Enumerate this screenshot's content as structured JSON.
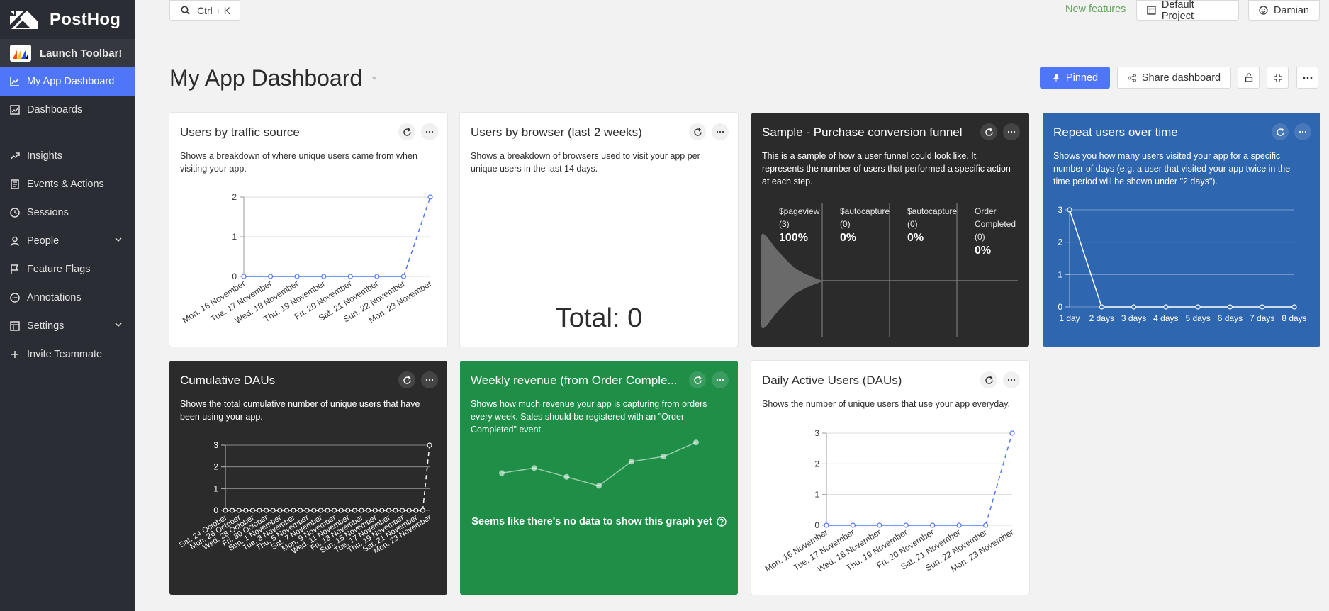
{
  "app": {
    "name": "PostHog"
  },
  "sidebar": {
    "toolbar_label": "Launch Toolbar!",
    "items": [
      {
        "label": "My App Dashboard",
        "icon": "line-chart-icon",
        "active": true
      },
      {
        "label": "Dashboards",
        "icon": "dashboard-icon"
      },
      {
        "label": "Insights",
        "icon": "trend-icon"
      },
      {
        "label": "Events & Actions",
        "icon": "list-icon"
      },
      {
        "label": "Sessions",
        "icon": "clock-icon"
      },
      {
        "label": "People",
        "icon": "user-icon",
        "expandable": true
      },
      {
        "label": "Feature Flags",
        "icon": "flag-icon"
      },
      {
        "label": "Annotations",
        "icon": "comment-icon"
      },
      {
        "label": "Settings",
        "icon": "settings-icon",
        "expandable": true
      },
      {
        "label": "Invite Teammate",
        "icon": "plus-icon"
      }
    ]
  },
  "topbar": {
    "search_label": "Ctrl + K",
    "new_features": "New features",
    "project": "Default Project",
    "user": "Damian"
  },
  "dashboard": {
    "title": "My App Dashboard",
    "pinned_label": "Pinned",
    "share_label": "Share dashboard"
  },
  "colors": {
    "accent": "#4f76f8",
    "sidebar": "#2a2d33",
    "dark_card": "#2b2b2b",
    "blue_card": "#2e66b0",
    "green_card": "#1f8f48",
    "new_features": "#63a35c"
  },
  "cards": {
    "traffic": {
      "title": "Users by traffic source",
      "description": "Shows a breakdown of where unique users came from when visiting your app."
    },
    "browser": {
      "title": "Users by browser (last 2 weeks)",
      "description": "Shows a breakdown of browsers used to visit your app per unique users in the last 14 days.",
      "total": "Total: 0"
    },
    "funnel": {
      "title": "Sample - Purchase conversion funnel",
      "description": "This is a sample of how a user funnel could look like. It represents the number of users that performed a specific action at each step.",
      "steps": [
        {
          "name": "$pageview",
          "count": "(3)",
          "pct": "100%"
        },
        {
          "name": "$autocapture",
          "count": "(0)",
          "pct": "0%"
        },
        {
          "name": "$autocapture",
          "count": "(0)",
          "pct": "0%"
        },
        {
          "name": "Order Completed",
          "count": "(0)",
          "pct": "0%"
        }
      ]
    },
    "repeat": {
      "title": "Repeat users over time",
      "description": "Shows you how many users visited your app for a specific number of days (e.g. a user that visited your app twice in the time period will be shown under \"2 days\")."
    },
    "cumulative": {
      "title": "Cumulative DAUs",
      "description": "Shows the total cumulative number of unique users that have been using your app."
    },
    "revenue": {
      "title": "Weekly revenue (from Order Comple...",
      "description": "Shows how much revenue your app is capturing from orders every week. Sales should be registered with an \"Order Completed\" event.",
      "nodata": "Seems like there's no data to show this graph yet"
    },
    "dau": {
      "title": "Daily Active Users (DAUs)",
      "description": "Shows the number of unique users that use your app everyday."
    }
  },
  "chart_data": [
    {
      "id": "traffic",
      "type": "line",
      "categories": [
        "Mon. 16 November",
        "Tue. 17 November",
        "Wed. 18 November",
        "Thu. 19 November",
        "Fri. 20 November",
        "Sat. 21 November",
        "Sun. 22 November",
        "Mon. 23 November"
      ],
      "values": [
        0,
        0,
        0,
        0,
        0,
        0,
        0,
        2
      ],
      "yticks": [
        0,
        1,
        2
      ],
      "ylim": [
        0,
        2
      ],
      "grid": true
    },
    {
      "id": "repeat",
      "type": "line",
      "categories": [
        "1 day",
        "2 days",
        "3 days",
        "4 days",
        "5 days",
        "6 days",
        "7 days",
        "8 days"
      ],
      "values": [
        3,
        0,
        0,
        0,
        0,
        0,
        0,
        0
      ],
      "yticks": [
        0,
        1,
        2,
        3
      ],
      "ylim": [
        0,
        3
      ],
      "grid": true
    },
    {
      "id": "cumulative",
      "type": "line",
      "categories": [
        "Sat. 24 October",
        "Mon. 26 October",
        "Wed. 28 October",
        "Fri. 30 October",
        "Sun. 1 November",
        "Tue. 3 November",
        "Thu. 5 November",
        "Sat. 7 November",
        "Mon. 9 November",
        "Wed. 11 November",
        "Fri. 13 November",
        "Sun. 15 November",
        "Tue. 17 November",
        "Thu. 19 November",
        "Sat. 21 November",
        "Mon. 23 November"
      ],
      "values": [
        0,
        0,
        0,
        0,
        0,
        0,
        0,
        0,
        0,
        0,
        0,
        0,
        0,
        0,
        0,
        0,
        0,
        0,
        0,
        0,
        0,
        0,
        0,
        0,
        0,
        0,
        0,
        0,
        0,
        0,
        3
      ],
      "yticks": [
        0,
        1,
        2,
        3
      ],
      "ylim": [
        0,
        3
      ],
      "grid": true
    },
    {
      "id": "dau",
      "type": "line",
      "categories": [
        "Mon. 16 November",
        "Tue. 17 November",
        "Wed. 18 November",
        "Thu. 19 November",
        "Fri. 20 November",
        "Sat. 21 November",
        "Sun. 22 November",
        "Mon. 23 November"
      ],
      "values": [
        0,
        0,
        0,
        0,
        0,
        0,
        0,
        3
      ],
      "yticks": [
        0,
        1,
        2,
        3
      ],
      "ylim": [
        0,
        3
      ],
      "grid": true
    },
    {
      "id": "revenue",
      "type": "line",
      "values": [
        2.2,
        2.6,
        1.9,
        1.2,
        3.1,
        3.5,
        4.6
      ],
      "ylim": [
        0,
        5
      ],
      "grid": false
    }
  ]
}
